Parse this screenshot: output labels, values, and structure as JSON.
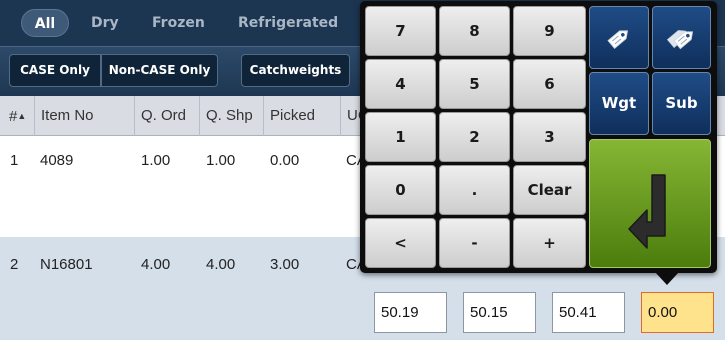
{
  "categories": {
    "tabs": [
      {
        "label": "All",
        "active": true
      },
      {
        "label": "Dry",
        "active": false
      },
      {
        "label": "Frozen",
        "active": false
      },
      {
        "label": "Refrigerated",
        "active": false
      }
    ]
  },
  "filters": {
    "case_only": "CASE Only",
    "non_case_only": "Non-CASE Only",
    "catchweights": "Catchweights"
  },
  "table": {
    "headers": [
      "#",
      "Item No",
      "Q. Ord",
      "Q. Shp",
      "Picked",
      "UC"
    ],
    "sort_indicator": "▲",
    "rows": [
      {
        "num": "1",
        "item_no": "4089",
        "q_ord": "1.00",
        "q_shp": "1.00",
        "picked": "0.00",
        "uom": "CA"
      },
      {
        "num": "2",
        "item_no": "N16801",
        "q_ord": "4.00",
        "q_shp": "4.00",
        "picked": "3.00",
        "uom": "CA"
      }
    ],
    "weights": [
      "50.19",
      "50.15",
      "50.41",
      "0.00"
    ]
  },
  "keypad": {
    "keys": [
      [
        "7",
        "8",
        "9"
      ],
      [
        "4",
        "5",
        "6"
      ],
      [
        "1",
        "2",
        "3"
      ],
      [
        "0",
        ".",
        "Clear"
      ],
      [
        "<",
        "-",
        "+"
      ]
    ],
    "wgt_label": "Wgt",
    "sub_label": "Sub"
  },
  "colors": {
    "header_bg": "#1c3550",
    "active_weight_bg": "#ffe38c",
    "active_weight_border": "#e26b2a",
    "enter_green": "#5e8f1a",
    "blue_key": "#173f74"
  }
}
